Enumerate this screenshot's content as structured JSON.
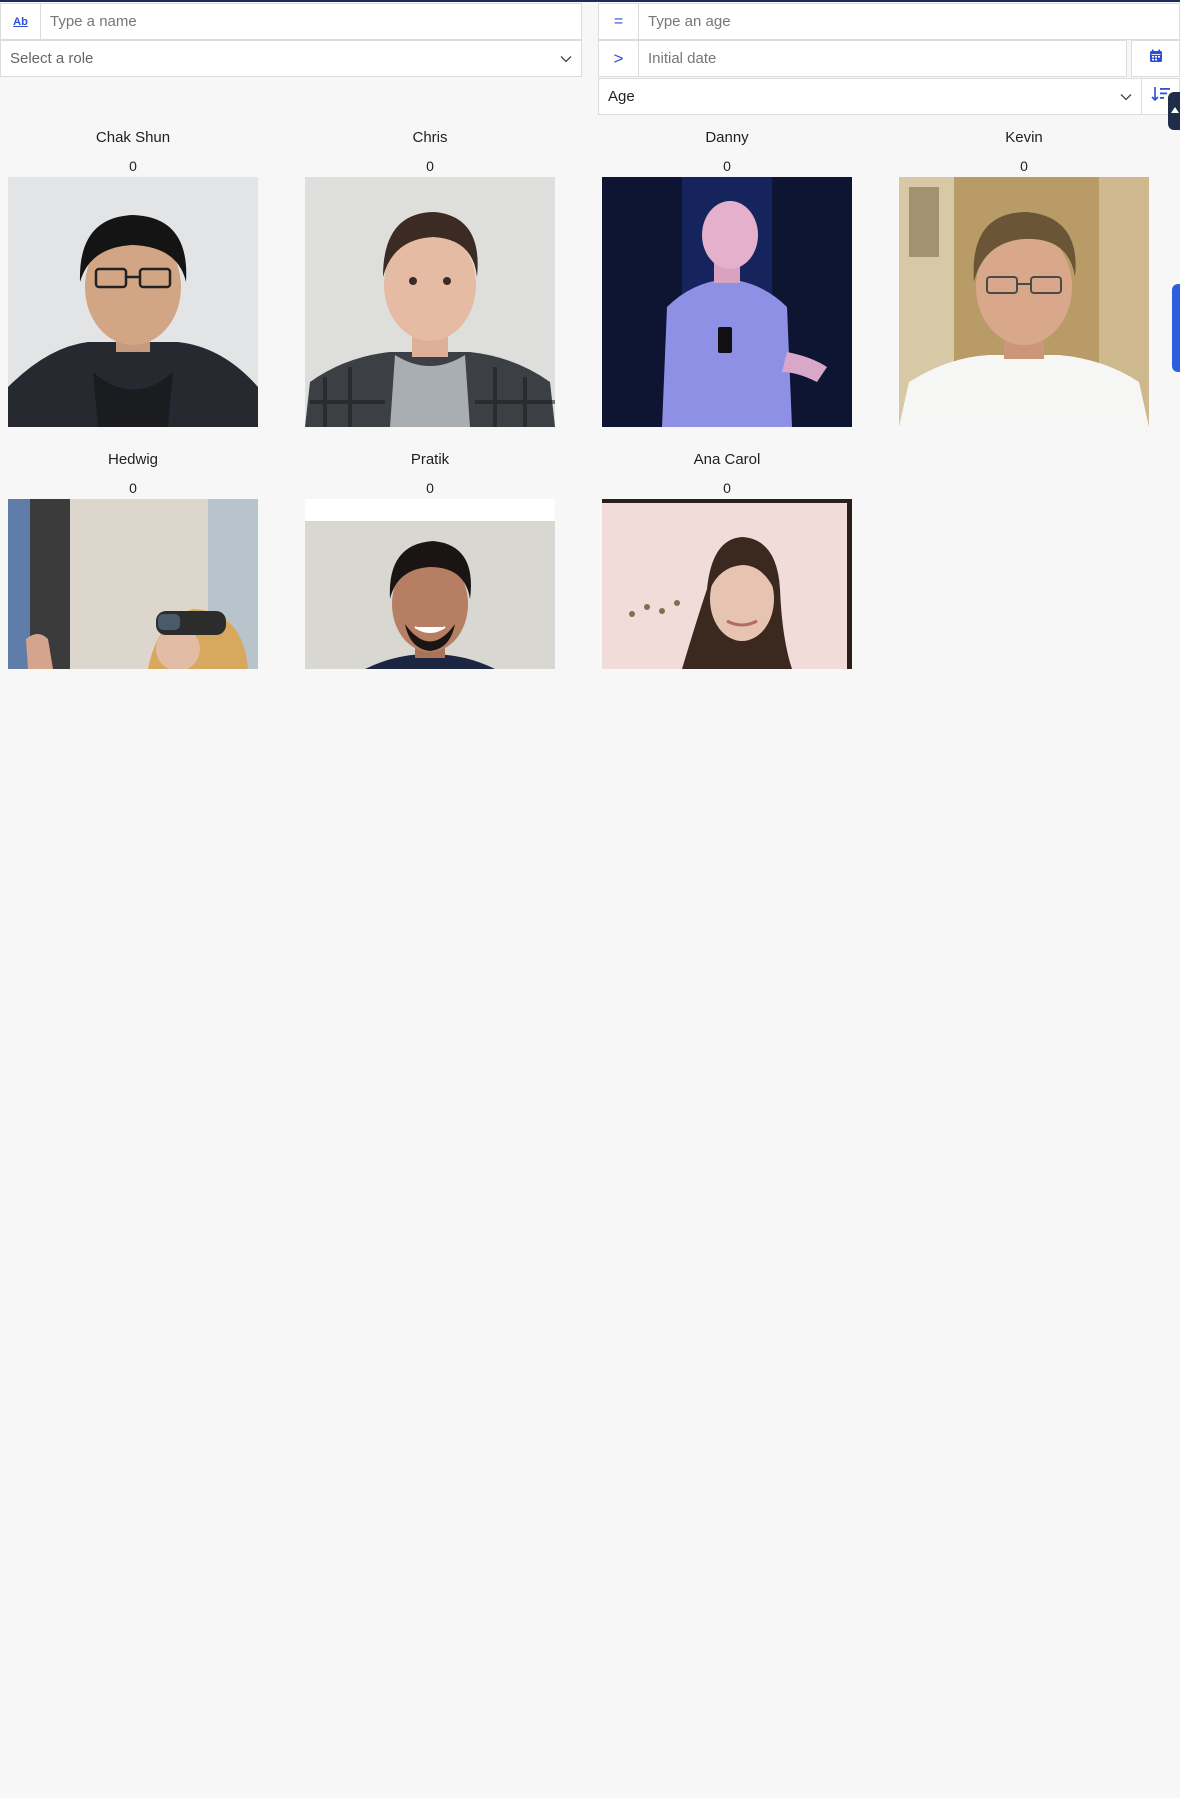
{
  "filters": {
    "name": {
      "prefix_label": "Ab",
      "placeholder": "Type a name"
    },
    "role": {
      "placeholder": "Select a role"
    },
    "age": {
      "operator": "=",
      "placeholder": "Type an age"
    },
    "date": {
      "operator": ">",
      "placeholder": "Initial date"
    },
    "sort": {
      "selected": "Age"
    }
  },
  "people": [
    {
      "name": "Chak Shun",
      "count": "0"
    },
    {
      "name": "Chris",
      "count": "0"
    },
    {
      "name": "Danny",
      "count": "0"
    },
    {
      "name": "Kevin",
      "count": "0"
    },
    {
      "name": "Hedwig",
      "count": "0"
    },
    {
      "name": "Pratik",
      "count": "0"
    },
    {
      "name": "Ana Carol",
      "count": "0"
    }
  ],
  "colors": {
    "accent": "#2c4fd6",
    "background": "#f7f7f7",
    "topline": "#1c2a5c"
  }
}
